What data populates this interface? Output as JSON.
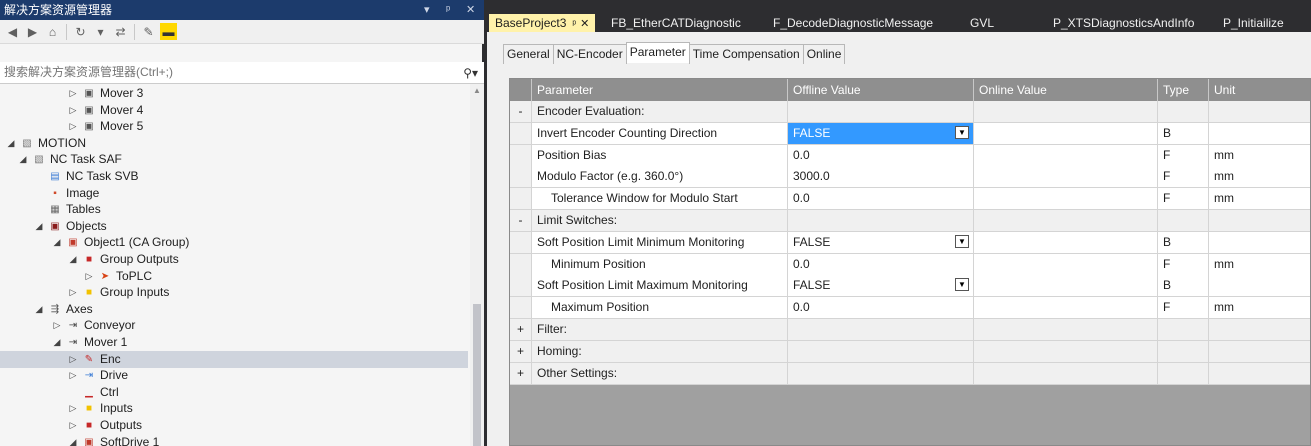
{
  "solution_explorer": {
    "title": "解决方案资源管理器",
    "title_controls": [
      "▾",
      "ᵖ",
      "✕"
    ],
    "search_placeholder": "搜索解决方案资源管理器(Ctrl+;)",
    "tree": [
      {
        "label": "Mover 3",
        "arrow": "▷",
        "icon": "axis-icon",
        "level": 4
      },
      {
        "label": "Mover 4",
        "arrow": "▷",
        "icon": "axis-icon",
        "level": 4
      },
      {
        "label": "Mover 5",
        "arrow": "▷",
        "icon": "axis-icon",
        "level": 4
      },
      {
        "label": "MOTION",
        "arrow": "◢",
        "icon": "motion-icon",
        "level": 0
      },
      {
        "label": "NC Task SAF",
        "arrow": "◢",
        "icon": "task-icon",
        "level": 1
      },
      {
        "label": "NC Task SVB",
        "arrow": "",
        "icon": "task-svb-icon",
        "level": 2
      },
      {
        "label": "Image",
        "arrow": "",
        "icon": "image-icon",
        "level": 2
      },
      {
        "label": "Tables",
        "arrow": "",
        "icon": "tables-icon",
        "level": 2
      },
      {
        "label": "Objects",
        "arrow": "◢",
        "icon": "objects-icon",
        "level": 2
      },
      {
        "label": "Object1 (CA Group)",
        "arrow": "◢",
        "icon": "object-icon",
        "level": 3
      },
      {
        "label": "Group Outputs",
        "arrow": "◢",
        "icon": "outputs-icon",
        "level": 4
      },
      {
        "label": "ToPLC",
        "arrow": "▷",
        "icon": "plc-icon",
        "level": 5
      },
      {
        "label": "Group Inputs",
        "arrow": "▷",
        "icon": "inputs-icon",
        "level": 4
      },
      {
        "label": "Axes",
        "arrow": "◢",
        "icon": "axes-icon",
        "level": 2
      },
      {
        "label": "Conveyor",
        "arrow": "▷",
        "icon": "axis-item-icon",
        "level": 3
      },
      {
        "label": "Mover 1",
        "arrow": "◢",
        "icon": "axis-item-icon",
        "level": 3
      },
      {
        "label": "Enc",
        "arrow": "▷",
        "icon": "encoder-icon",
        "level": 4,
        "selected": true
      },
      {
        "label": "Drive",
        "arrow": "▷",
        "icon": "drive-icon",
        "level": 4
      },
      {
        "label": "Ctrl",
        "arrow": "",
        "icon": "ctrl-icon",
        "level": 4
      },
      {
        "label": "Inputs",
        "arrow": "▷",
        "icon": "inputs-icon",
        "level": 4
      },
      {
        "label": "Outputs",
        "arrow": "▷",
        "icon": "outputs-icon",
        "level": 4
      },
      {
        "label": "SoftDrive 1",
        "arrow": "◢",
        "icon": "softdrive-icon",
        "level": 4
      }
    ]
  },
  "document_tabs": [
    {
      "label": "BaseProject3",
      "active": true,
      "pin": "ᵖ",
      "close": "✕"
    },
    {
      "label": "FB_EtherCATDiagnostic"
    },
    {
      "label": "F_DecodeDiagnosticMessage"
    },
    {
      "label": "GVL"
    },
    {
      "label": "P_XTSDiagnosticsAndInfo"
    },
    {
      "label": "P_Initiailize"
    }
  ],
  "sub_tabs": [
    {
      "label": "General"
    },
    {
      "label": "NC-Encoder"
    },
    {
      "label": "Parameter",
      "active": true
    },
    {
      "label": "Time Compensation"
    },
    {
      "label": "Online"
    }
  ],
  "grid": {
    "columns": [
      "Parameter",
      "Offline Value",
      "Online Value",
      "Type",
      "Unit"
    ],
    "rows": [
      {
        "expander": "-",
        "parameter": "Encoder Evaluation:",
        "group": true
      },
      {
        "expander": "",
        "parameter": "Invert Encoder Counting Direction",
        "offline": "FALSE",
        "dropdown": true,
        "highlighted": true,
        "type": "B",
        "unit": ""
      },
      {
        "expander": "",
        "parameter": "Position Bias",
        "offline": "0.0",
        "type": "F",
        "unit": "mm"
      },
      {
        "expander": "",
        "parameter": "Modulo Factor (e.g. 360.0°)",
        "offline": "3000.0",
        "type": "F",
        "unit": "mm"
      },
      {
        "expander": "",
        "parameter": "Tolerance Window for Modulo Start",
        "offline": "0.0",
        "type": "F",
        "unit": "mm",
        "indent": true
      },
      {
        "expander": "-",
        "parameter": "Limit Switches:",
        "group": true
      },
      {
        "expander": "",
        "parameter": "Soft Position Limit Minimum Monitoring",
        "offline": "FALSE",
        "dropdown": true,
        "type": "B",
        "unit": ""
      },
      {
        "expander": "",
        "parameter": "Minimum Position",
        "offline": "0.0",
        "type": "F",
        "unit": "mm",
        "indent": true
      },
      {
        "expander": "",
        "parameter": "Soft Position Limit Maximum Monitoring",
        "offline": "FALSE",
        "dropdown": true,
        "type": "B",
        "unit": ""
      },
      {
        "expander": "",
        "parameter": "Maximum Position",
        "offline": "0.0",
        "type": "F",
        "unit": "mm",
        "indent": true
      },
      {
        "expander": "+",
        "parameter": "Filter:",
        "group": true
      },
      {
        "expander": "+",
        "parameter": "Homing:",
        "group": true
      },
      {
        "expander": "+",
        "parameter": "Other Settings:",
        "group": true
      }
    ]
  },
  "colors": {
    "title_bar": "#1c3b6c",
    "active_doc_tab": "#fff2aa",
    "selection": "#3399ff",
    "header_bg": "#8f8f8f"
  }
}
